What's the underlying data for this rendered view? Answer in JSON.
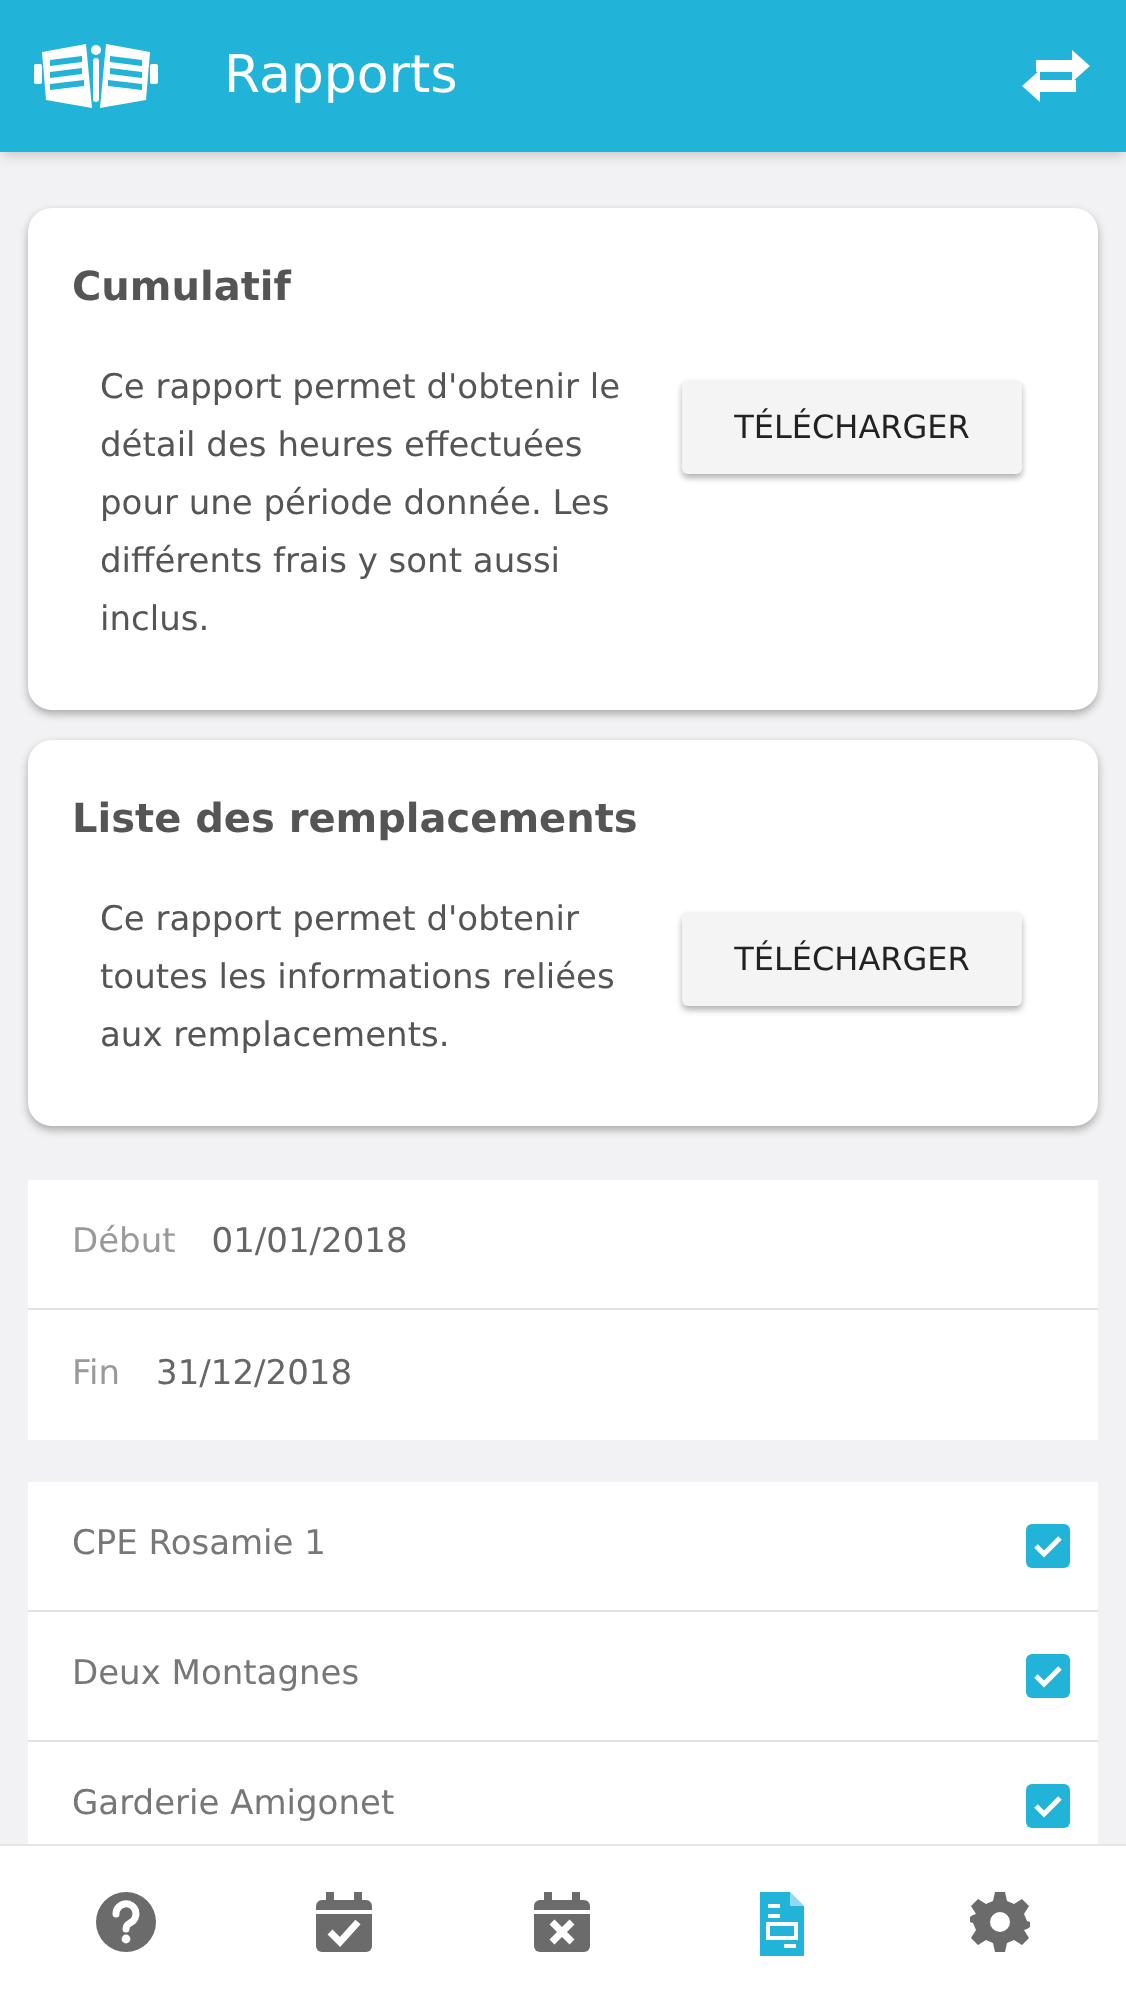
{
  "header": {
    "title": "Rapports"
  },
  "reports": [
    {
      "title": "Cumulatif",
      "description": "Ce rapport permet d'obtenir le détail des heures effectuées pour une période donnée. Les différents frais y sont aussi inclus.",
      "button": "TÉLÉCHARGER"
    },
    {
      "title": "Liste des remplacements",
      "description": "Ce rapport permet d'obtenir toutes les informations reliées aux remplacements.",
      "button": "TÉLÉCHARGER"
    }
  ],
  "dates": [
    {
      "label": "Début",
      "value": "01/01/2018"
    },
    {
      "label": "Fin",
      "value": "31/12/2018"
    }
  ],
  "places": [
    {
      "name": "CPE Rosamie 1",
      "checked": true
    },
    {
      "name": "Deux Montagnes",
      "checked": true
    },
    {
      "name": "Garderie Amigonet",
      "checked": true
    }
  ],
  "nav": [
    {
      "kind": "help",
      "selected": false
    },
    {
      "kind": "calendar-check",
      "selected": false
    },
    {
      "kind": "calendar-cross",
      "selected": false
    },
    {
      "kind": "report",
      "selected": true
    },
    {
      "kind": "settings",
      "selected": false
    }
  ]
}
